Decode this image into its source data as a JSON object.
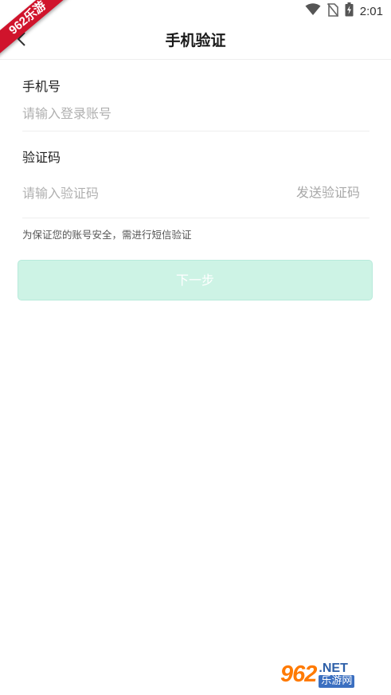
{
  "status_bar": {
    "time": "2:01",
    "icons": [
      "wifi-icon",
      "no-sim-icon",
      "battery-charging-icon"
    ]
  },
  "badge": {
    "text": "962乐游"
  },
  "header": {
    "title": "手机验证",
    "back_icon": "chevron-left-icon"
  },
  "form": {
    "phone": {
      "label": "手机号",
      "value": "",
      "placeholder": "请输入登录账号"
    },
    "code": {
      "label": "验证码",
      "value": "",
      "placeholder": "请输入验证码",
      "send_label": "发送验证码"
    },
    "hint": "为保证您的账号安全，需进行短信验证"
  },
  "actions": {
    "next_label": "下一步"
  },
  "watermark": {
    "logo": "962",
    "net": ".NET",
    "name": "乐游网"
  },
  "colors": {
    "badge_red": "#d0142c",
    "button_bg": "#cdf3e5",
    "placeholder": "#b0b0b0",
    "watermark_orange": "#ff7a00",
    "watermark_blue": "#3b6fc0"
  }
}
